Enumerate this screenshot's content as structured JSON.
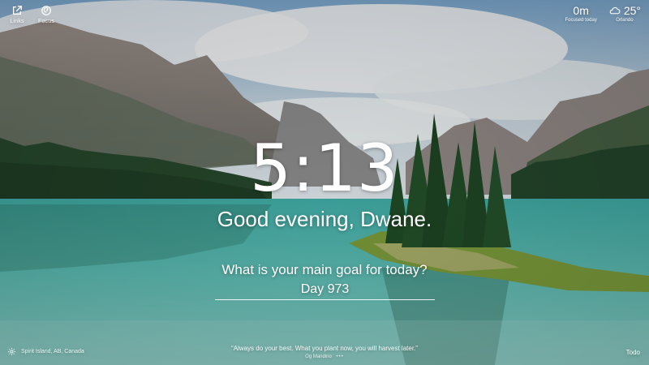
{
  "top_left": {
    "links_label": "Links",
    "focus_label": "Focus",
    "links_icon": "external-link-icon",
    "focus_icon": "focus-spiral-icon"
  },
  "focus_widget": {
    "value": "0m",
    "label": "Focused today"
  },
  "weather": {
    "temperature": "25°",
    "location": "Orlando",
    "icon": "cloud-icon"
  },
  "clock": "5:13",
  "greeting": "Good evening, Dwane.",
  "goal": {
    "prompt": "What is your main goal for today?",
    "value": "Day 973"
  },
  "photo_location": "Spirit Island, AB, Canada",
  "settings_icon": "gear-icon",
  "quote": {
    "text": "“Always do your best. What you plant now, you will harvest later.”",
    "author": "Og Mandino",
    "more": "•••"
  },
  "todo_label": "Todo",
  "colors": {
    "text": "#ffffff",
    "water": "#4fb2aa",
    "sky": "#8fb6d4",
    "forest": "#27502f"
  }
}
